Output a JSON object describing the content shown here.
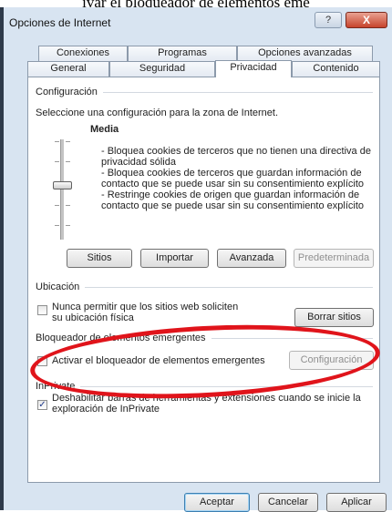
{
  "caption": "ivar el bloqueador de elementos eme",
  "window": {
    "title": "Opciones de Internet",
    "help_label": "?",
    "close_label": "X"
  },
  "tabs_back": [
    "Conexiones",
    "Programas",
    "Opciones avanzadas"
  ],
  "tabs_front": [
    "General",
    "Seguridad",
    "Privacidad",
    "Contenido"
  ],
  "active_tab": "Privacidad",
  "configuracion": {
    "heading": "Configuración",
    "instruction": "Seleccione una configuración para la zona de Internet.",
    "level": "Media",
    "bullets": [
      "- Bloquea cookies de terceros que no tienen una directiva de",
      "privacidad sólida",
      "- Bloquea cookies de terceros que guardan información de",
      "contacto que se puede usar sin su consentimiento explícito",
      "- Restringe cookies de origen que guardan información de",
      "contacto que se puede usar sin su consentimiento explícito"
    ],
    "buttons": {
      "sitios": "Sitios",
      "importar": "Importar",
      "avanzada": "Avanzada",
      "predeterminada": "Predeterminada"
    }
  },
  "ubicacion": {
    "heading": "Ubicación",
    "checkbox_line1": "Nunca permitir que los sitios web soliciten",
    "checkbox_line2": "su ubicación física",
    "checked": false,
    "clear_button": "Borrar sitios"
  },
  "bloqueador": {
    "heading": "Bloqueador de elementos emergentes",
    "checkbox_label": "Activar el bloqueador de elementos emergentes",
    "checked": false,
    "config_button": "Configuración"
  },
  "inprivate": {
    "heading": "InPrivate",
    "checkbox_line1": "Deshabilitar barras de herramientas y extensiones cuando se inicie la",
    "checkbox_line2": "exploración de InPrivate",
    "checked": true
  },
  "footer": {
    "aceptar": "Aceptar",
    "cancelar": "Cancelar",
    "aplicar": "Aplicar"
  },
  "colors": {
    "annotation": "#e0141b",
    "window_frame": "#d8e4f1"
  }
}
